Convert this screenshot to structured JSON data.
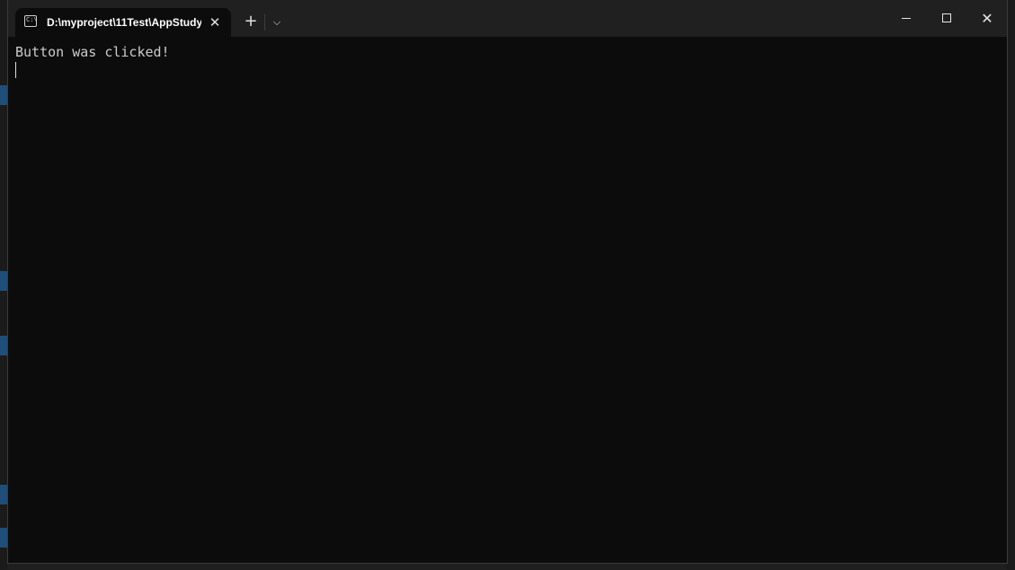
{
  "window": {
    "tab_title": "D:\\myproject\\11Test\\AppStudy",
    "tab_icon": "terminal-icon",
    "tab_icon_glyph": "C:\\",
    "close_tab_glyph": "✕",
    "new_tab_glyph": "+",
    "dropdown_glyph": "⌵",
    "close_glyph": "✕"
  },
  "terminal": {
    "lines": [
      "Button was clicked!"
    ]
  },
  "colors": {
    "terminal_bg": "#0c0c0c",
    "titlebar_bg": "#202020",
    "text": "#cccccc"
  }
}
